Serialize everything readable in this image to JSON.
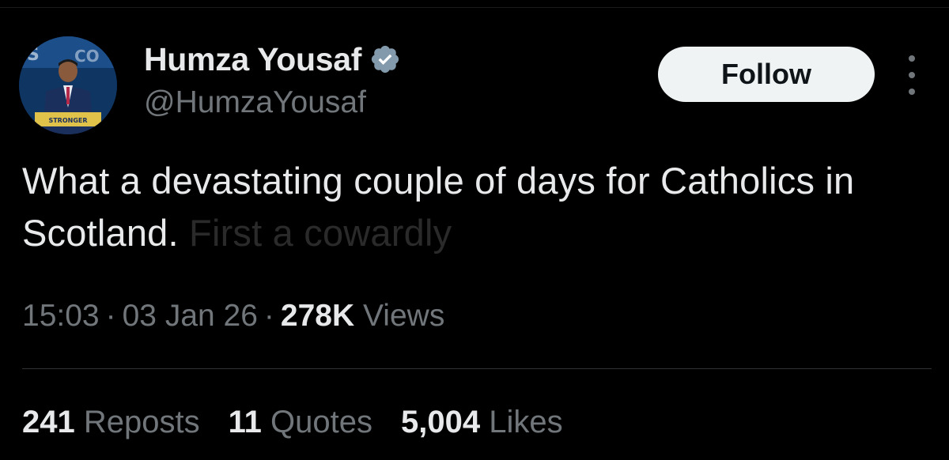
{
  "author": {
    "display_name": "Humza Yousaf",
    "handle": "@HumzaYousaf",
    "verified": true,
    "avatar_sign_text": "STRONGER"
  },
  "follow_button": {
    "label": "Follow"
  },
  "tweet": {
    "text_visible": "What a devastating couple of days for Catholics in Scotland.",
    "text_faded": "First a cowardly"
  },
  "meta": {
    "time": "15:03",
    "date": "03 Jan 26",
    "views_count": "278K",
    "views_label": "Views",
    "separator": "·"
  },
  "stats": {
    "reposts_count": "241",
    "reposts_label": "Reposts",
    "quotes_count": "11",
    "quotes_label": "Quotes",
    "likes_count": "5,004",
    "likes_label": "Likes"
  },
  "colors": {
    "background": "#000000",
    "primary_text": "#e7e9ea",
    "secondary_text": "#71767b",
    "verified_badge": "#829aab",
    "follow_button_bg": "#eff3f4"
  },
  "icons": {
    "verified": "verified-badge-icon",
    "more": "more-options-icon"
  }
}
